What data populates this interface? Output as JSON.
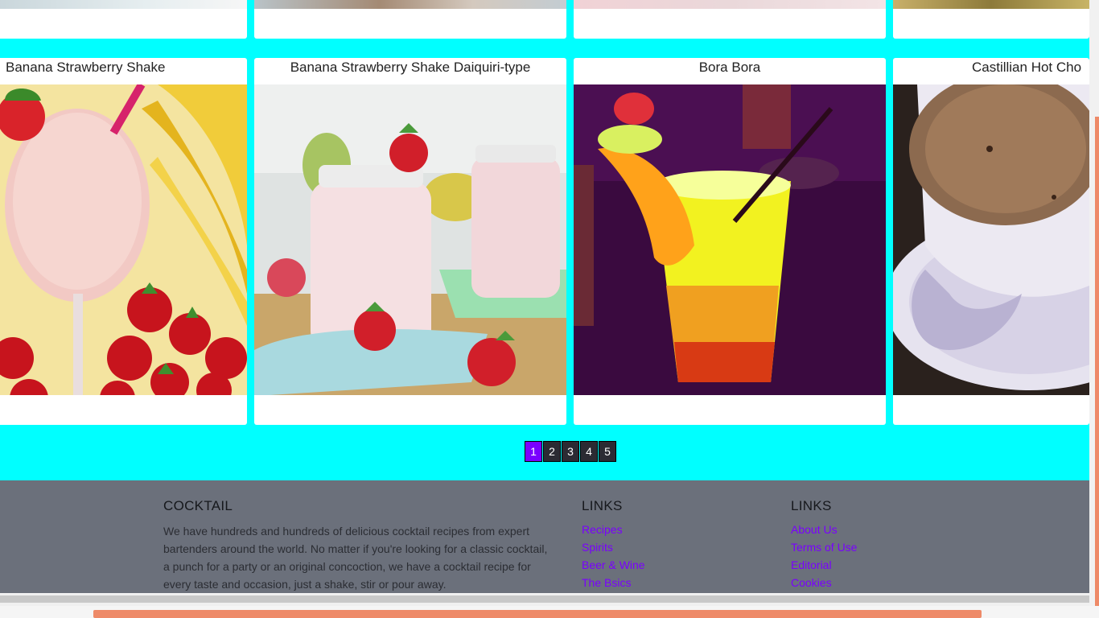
{
  "cards": [
    {
      "title": "Banana Strawberry Shake",
      "image": "banana-strawberry-shake-photo"
    },
    {
      "title": "Banana Strawberry Shake Daiquiri-type",
      "image": "banana-strawberry-daiquiri-photo"
    },
    {
      "title": "Bora Bora",
      "image": "bora-bora-cocktail-photo"
    },
    {
      "title": "Castillian Hot Cho",
      "image": "castillian-hot-chocolate-photo"
    }
  ],
  "pagination": {
    "pages": [
      "1",
      "2",
      "3",
      "4",
      "5"
    ],
    "active": "1"
  },
  "footer": {
    "about": {
      "heading": "COCKTAIL",
      "text": "We have hundreds and hundreds of delicious cocktail recipes from expert bartenders around the world. No matter if you're looking for a classic cocktail, a punch for a party or an original concoction, we have a cocktail recipe for every taste and occasion, just a shake, stir or pour away."
    },
    "links1": {
      "heading": "LINKS",
      "items": [
        "Recipes",
        "Spirits",
        "Beer & Wine",
        "The Bsics"
      ]
    },
    "links2": {
      "heading": "LINKS",
      "items": [
        "About Us",
        "Terms of Use",
        "Editorial",
        "Cookies"
      ]
    }
  },
  "colors": {
    "background": "#00ffff",
    "accent": "#7a00ff",
    "footer": "#6b707b"
  }
}
